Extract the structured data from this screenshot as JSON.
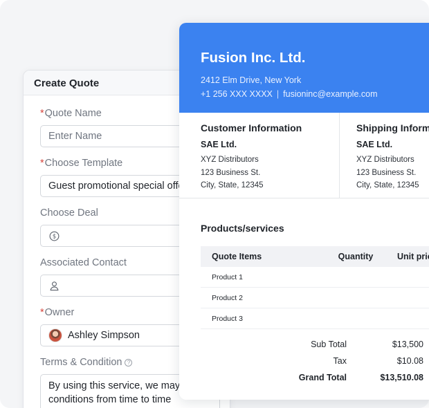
{
  "form": {
    "title": "Create Quote",
    "quote_name": {
      "label": "Quote Name",
      "required": true,
      "placeholder": "Enter Name"
    },
    "template": {
      "label": "Choose Template",
      "required": true,
      "value": "Guest promotional special offer"
    },
    "deal": {
      "label": "Choose Deal",
      "icon": "dollar-circle-icon"
    },
    "contact": {
      "label": "Associated Contact",
      "icon": "person-icon"
    },
    "owner": {
      "label": "Owner",
      "required": true,
      "value": "Ashley Simpson"
    },
    "terms": {
      "label": "Terms & Condition",
      "help": "?",
      "line1": "By using this service, we may",
      "line2": "conditions from time to time"
    },
    "required_mark": "*"
  },
  "quote": {
    "company": {
      "name": "Fusion Inc. Ltd.",
      "address": "2412 Elm Drive, New York",
      "phone": "+1 256 XXX XXXX",
      "separator": "|",
      "email": "fusioninc@example.com"
    },
    "customer": {
      "title": "Customer Information",
      "name": "SAE Ltd.",
      "line1": "XYZ Distributors",
      "line2": "123 Business St.",
      "line3": "City, State, 12345"
    },
    "shipping": {
      "title": "Shipping Information",
      "name": "SAE Ltd.",
      "line1": "XYZ Distributors",
      "line2": "123 Business St.",
      "line3": "City, State, 12345"
    },
    "products": {
      "title": "Products/services",
      "headers": {
        "item": "Quote Items",
        "qty": "Quantity",
        "price": "Unit price"
      },
      "rows": [
        {
          "item": "Product 1"
        },
        {
          "item": "Product 2"
        },
        {
          "item": "Product 3"
        }
      ]
    },
    "totals": {
      "subtotal_label": "Sub Total",
      "subtotal_value": "$13,500",
      "tax_label": "Tax",
      "tax_value": "$10.08",
      "grand_label": "Grand Total",
      "grand_value": "$13,510.08"
    }
  },
  "colors": {
    "header_blue": "#3b82f0",
    "required_red": "#d6453d"
  }
}
